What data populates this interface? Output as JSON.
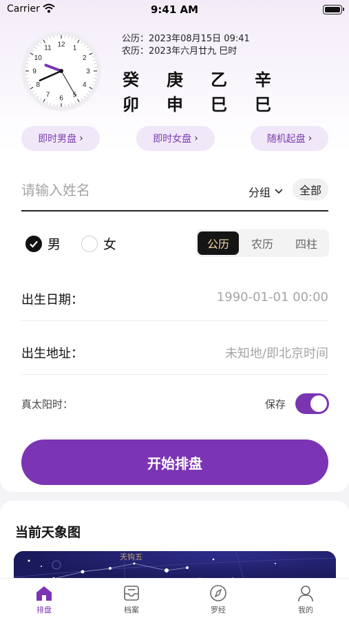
{
  "status_bar": {
    "carrier": "Carrier",
    "time": "9:41 AM"
  },
  "calendar": {
    "solar": "公历：2023年08月15日 09:41",
    "lunar": "农历：2023年六月廿九 巳时",
    "ganzhi_top": [
      "癸",
      "庚",
      "乙",
      "辛"
    ],
    "ganzhi_bottom": [
      "卯",
      "申",
      "巳",
      "巳"
    ]
  },
  "clock": {
    "numerals": [
      "12",
      "1",
      "2",
      "3",
      "4",
      "5",
      "6",
      "7",
      "8",
      "9",
      "10",
      "11"
    ],
    "hour": 9,
    "minute": 41,
    "second": 25
  },
  "quick_actions": [
    "即时男盘",
    "即时女盘",
    "随机起盘"
  ],
  "name_input": {
    "placeholder": "请输入姓名",
    "value": ""
  },
  "group": {
    "label": "分组",
    "all_label": "全部"
  },
  "gender": {
    "male": "男",
    "female": "女",
    "selected": "male"
  },
  "calendar_type": {
    "options": [
      "公历",
      "农历",
      "四柱"
    ],
    "selected": "公历"
  },
  "birth_date": {
    "label": "出生日期：",
    "value": "1990-01-01 00:00"
  },
  "birth_place": {
    "label": "出生地址：",
    "value": "未知地/即北京时间"
  },
  "true_solar": {
    "label": "真太阳时：",
    "save_label": "保存",
    "enabled": true
  },
  "start_button": "开始排盘",
  "sky": {
    "title": "当前天象图",
    "star_label": "天钩五"
  },
  "tabs": [
    {
      "label": "排盘",
      "icon": "home-icon",
      "active": true
    },
    {
      "label": "档案",
      "icon": "archive-icon",
      "active": false
    },
    {
      "label": "罗经",
      "icon": "compass-icon",
      "active": false
    },
    {
      "label": "我的",
      "icon": "profile-icon",
      "active": false
    }
  ],
  "colors": {
    "accent": "#7b34b3",
    "accent_light": "#f0e7f8",
    "gold": "#f2d6a8",
    "sky": "#1b1a5c"
  }
}
